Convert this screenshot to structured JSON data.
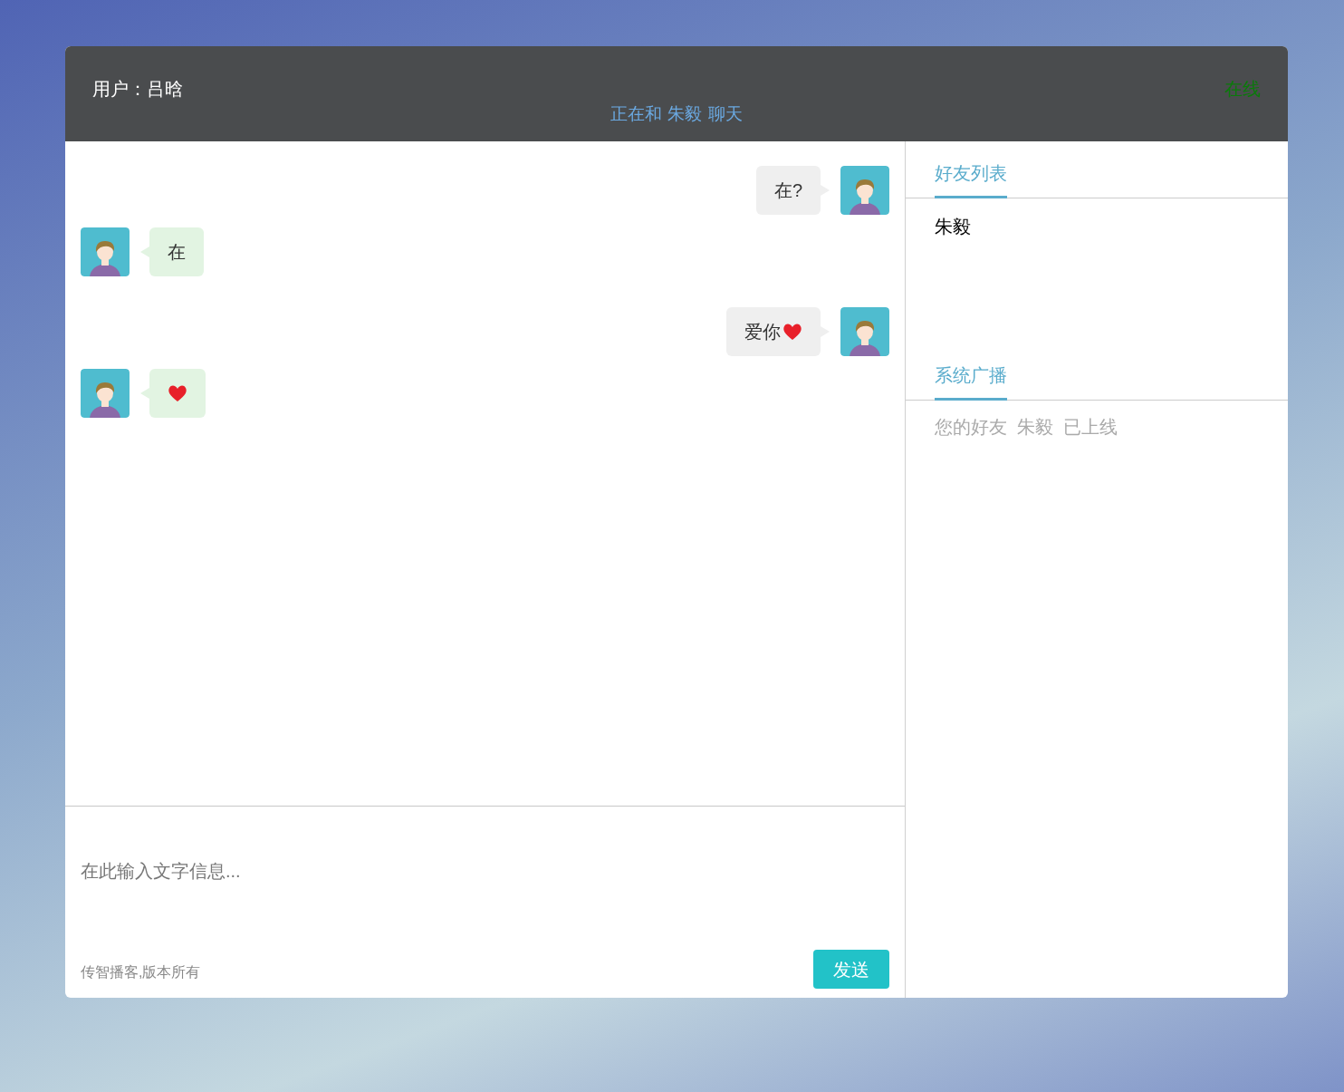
{
  "header": {
    "user": "用户：吕晗",
    "chatting_with": "正在和 朱毅 聊天",
    "status": "在线"
  },
  "messages": [
    {
      "kind": "sent",
      "parts": [
        {
          "kind": "text",
          "text": "在?"
        }
      ]
    },
    {
      "kind": "received",
      "parts": [
        {
          "kind": "text",
          "text": "在"
        }
      ]
    },
    {
      "kind": "sent",
      "parts": [
        {
          "kind": "text",
          "text": "爱你"
        },
        {
          "kind": "heart"
        }
      ]
    },
    {
      "kind": "received",
      "parts": [
        {
          "kind": "heart"
        }
      ]
    }
  ],
  "composer": {
    "placeholder": "在此输入文字信息...",
    "copyright": "传智播客,版本所有",
    "send": "发送"
  },
  "friends": {
    "title": "好友列表",
    "items": [
      "朱毅"
    ]
  },
  "broadcast": {
    "title": "系统广播",
    "items": [
      "您的好友  朱毅  已上线"
    ]
  }
}
